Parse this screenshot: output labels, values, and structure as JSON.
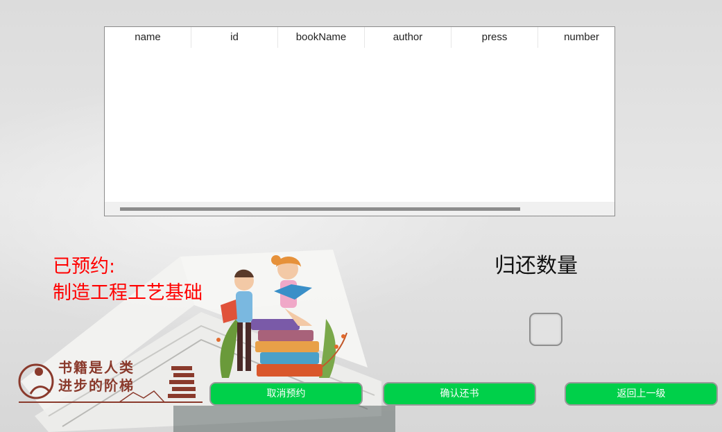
{
  "table": {
    "columns": [
      "name",
      "id",
      "bookName",
      "author",
      "press",
      "number"
    ],
    "rows": []
  },
  "reserved": {
    "label": "已预约:",
    "book": "制造工程工艺基础"
  },
  "return_section": {
    "label": "归还数量",
    "quantity_value": ""
  },
  "buttons": {
    "cancel_reservation": "取消预约",
    "confirm_return": "确认还书",
    "back": "返回上一级"
  },
  "logo": {
    "line1": "书籍是人类",
    "line2": "进步的阶梯"
  },
  "colors": {
    "button_green": "#00d04a",
    "reserved_red": "#ff0000"
  }
}
